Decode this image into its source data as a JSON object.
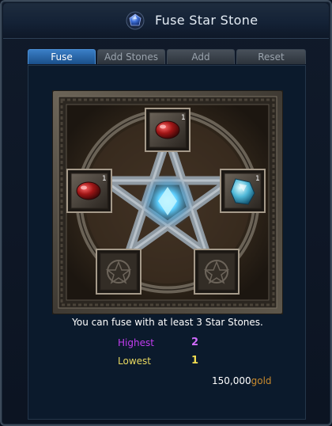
{
  "window": {
    "title": "Fuse Star Stone"
  },
  "tabs": [
    {
      "label": "Fuse",
      "active": true
    },
    {
      "label": "Add Stones",
      "active": false
    },
    {
      "label": "Add",
      "active": false
    },
    {
      "label": "Reset",
      "active": false
    }
  ],
  "slots": {
    "top": {
      "count": "1",
      "stone": "red"
    },
    "left": {
      "count": "1",
      "stone": "red"
    },
    "right": {
      "count": "1",
      "stone": "blue"
    },
    "bottom_left": {
      "count": "",
      "stone": "empty"
    },
    "bottom_right": {
      "count": "",
      "stone": "empty"
    }
  },
  "info": {
    "message": "You can fuse with at least 3 Star Stones.",
    "highest_label": "Highest",
    "highest_value": "2",
    "lowest_label": "Lowest",
    "lowest_value": "1"
  },
  "cost": {
    "amount": "150,000",
    "unit": "gold"
  },
  "colors": {
    "highest": "#c23cf0",
    "highest_value": "#d26cff",
    "lowest": "#e8d860",
    "lowest_value": "#f0dc50",
    "accent_tab": "#2a6bb0"
  }
}
